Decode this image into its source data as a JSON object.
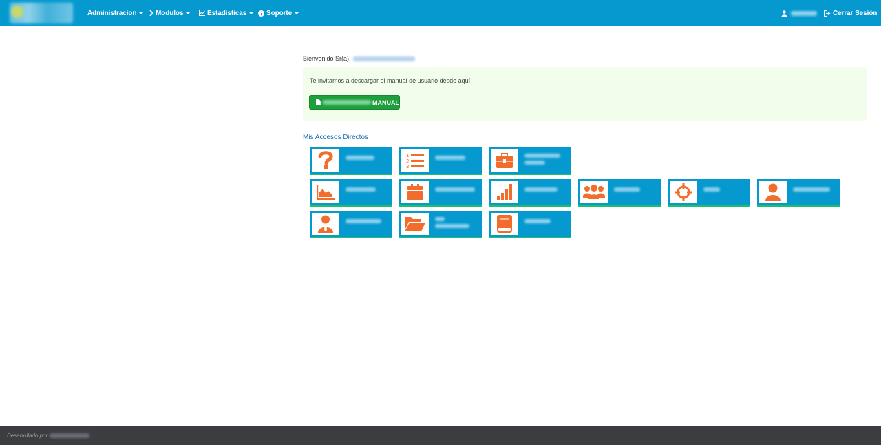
{
  "nav": {
    "menu": [
      {
        "label": "Administracion",
        "icon": "none"
      },
      {
        "label": "Modulos",
        "icon": "chevron-right-icon"
      },
      {
        "label": "Estadisticas",
        "icon": "line-chart-icon"
      },
      {
        "label": "Soporte",
        "icon": "info-circle-icon"
      }
    ],
    "logout_label": "Cerrar Sesión",
    "user_icon": "user-icon"
  },
  "welcome": {
    "label": "Bienvenido Sr(a)"
  },
  "alert": {
    "text": "Te invitamos a descargar el manual de usuario desde aquí.",
    "button_label": "MANUAL"
  },
  "shortcuts": {
    "title": "Mis Accesos Directos",
    "tiles": [
      {
        "icon": "question-icon",
        "lines": 1
      },
      {
        "icon": "list-ordered-icon",
        "lines": 1
      },
      {
        "icon": "briefcase-icon",
        "lines": 2
      },
      {
        "icon": "area-chart-icon",
        "lines": 1
      },
      {
        "icon": "calendar-icon",
        "lines": 1
      },
      {
        "icon": "bar-chart-icon",
        "lines": 1
      },
      {
        "icon": "users-icon",
        "lines": 1
      },
      {
        "icon": "crosshairs-icon",
        "lines": 1
      },
      {
        "icon": "user-icon",
        "lines": 1
      },
      {
        "icon": "user-tie-icon",
        "lines": 1
      },
      {
        "icon": "folder-open-icon",
        "lines": 2
      },
      {
        "icon": "book-icon",
        "lines": 1
      }
    ]
  },
  "footer": {
    "text": "Desarrollado por"
  },
  "colors": {
    "navbar": "#0599cf",
    "tile": "#0599cf",
    "tile_border": "#1cbf6b",
    "icon": "#f26c2c",
    "button": "#1e9e3c",
    "footer": "#3c3d41",
    "alert_bg": "#f2fdec"
  }
}
